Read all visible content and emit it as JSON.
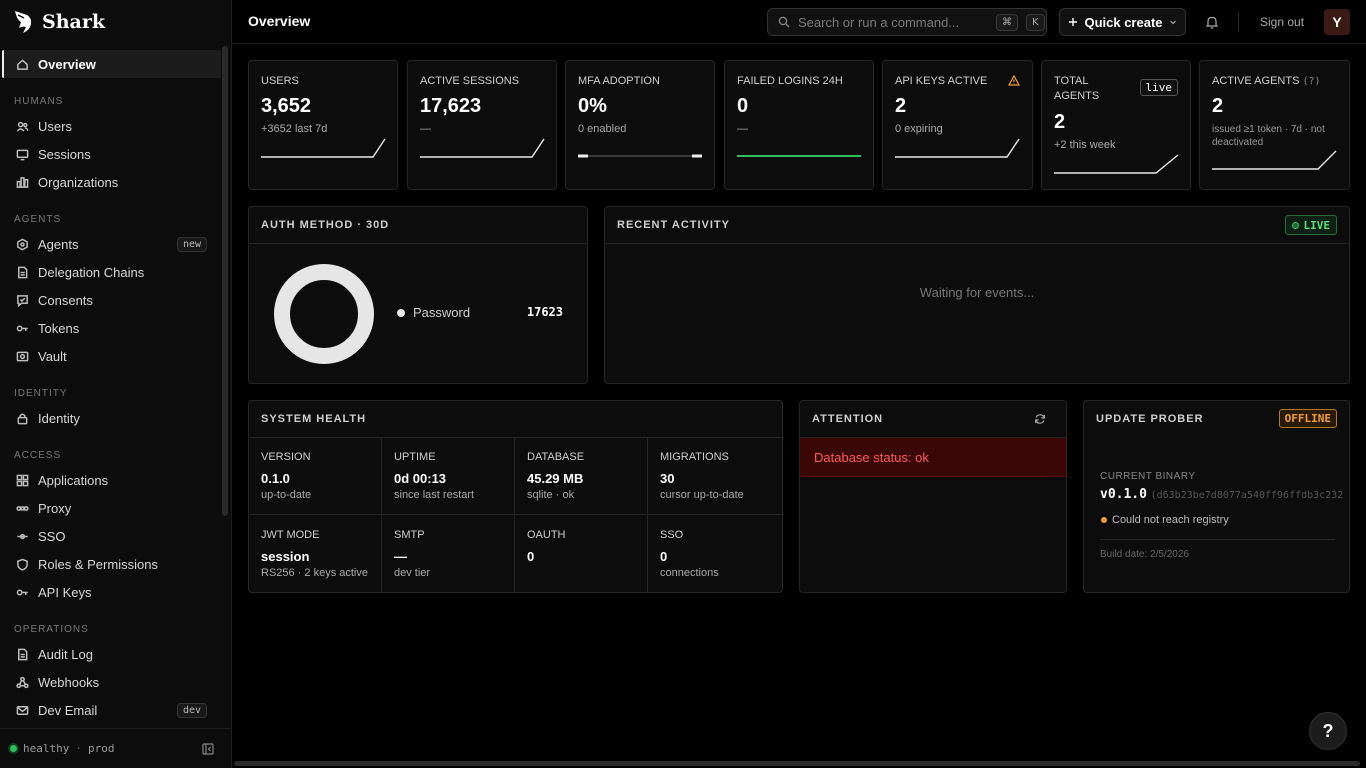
{
  "app": {
    "name": "Shark"
  },
  "header": {
    "title": "Overview",
    "search_placeholder": "Search or run a command...",
    "shortcut_key1": "⌘",
    "shortcut_key2": "K",
    "quick_create_label": "Quick create",
    "sign_out_label": "Sign out",
    "avatar_initial": "Y"
  },
  "sidebar": {
    "overview": "Overview",
    "sections": {
      "humans": "HUMANS",
      "agents": "AGENTS",
      "identity": "IDENTITY",
      "access": "ACCESS",
      "operations": "OPERATIONS"
    },
    "items": {
      "users": "Users",
      "sessions": "Sessions",
      "organizations": "Organizations",
      "agents": "Agents",
      "delegation": "Delegation Chains",
      "consents": "Consents",
      "tokens": "Tokens",
      "vault": "Vault",
      "identity": "Identity",
      "applications": "Applications",
      "proxy": "Proxy",
      "sso": "SSO",
      "roles": "Roles & Permissions",
      "apikeys": "API Keys",
      "audit": "Audit Log",
      "webhooks": "Webhooks",
      "devemail": "Dev Email"
    },
    "badges": {
      "agents": "new",
      "devemail": "dev"
    },
    "footer": {
      "status": "healthy",
      "sep": "·",
      "env": "prod"
    }
  },
  "stats": [
    {
      "label": "USERS",
      "value": "3,652",
      "sub": "+3652 last 7d"
    },
    {
      "label": "ACTIVE SESSIONS",
      "value": "17,623",
      "sub": "—"
    },
    {
      "label": "MFA ADOPTION",
      "value": "0%",
      "sub": "0 enabled"
    },
    {
      "label": "FAILED LOGINS 24H",
      "value": "0",
      "sub": "—"
    },
    {
      "label": "API KEYS ACTIVE",
      "value": "2",
      "sub": "0 expiring"
    },
    {
      "label": "TOTAL AGENTS",
      "value": "2",
      "sub": "+2 this week",
      "pill": "live"
    },
    {
      "label": "ACTIVE AGENTS",
      "hint": "(?)",
      "value": "2",
      "sub": "issued ≥1 token · 7d · not deactivated"
    }
  ],
  "auth_method": {
    "title": "AUTH METHOD · 30D",
    "legend": [
      {
        "name": "Password",
        "value": "17623"
      }
    ]
  },
  "recent_activity": {
    "title": "RECENT ACTIVITY",
    "live_label": "LIVE",
    "empty": "Waiting for events..."
  },
  "system_health": {
    "title": "SYSTEM HEALTH",
    "cells": [
      {
        "k": "VERSION",
        "v": "0.1.0",
        "s": "up-to-date"
      },
      {
        "k": "UPTIME",
        "v": "0d 00:13",
        "s": "since last restart"
      },
      {
        "k": "DATABASE",
        "v": "45.29 MB",
        "s": "sqlite · ok"
      },
      {
        "k": "MIGRATIONS",
        "v": "30",
        "s": "cursor up-to-date"
      },
      {
        "k": "JWT MODE",
        "v": "session",
        "s": "RS256 · 2 keys active"
      },
      {
        "k": "SMTP",
        "v": "—",
        "s": "dev tier"
      },
      {
        "k": "OAUTH",
        "v": "0",
        "s": ""
      },
      {
        "k": "SSO",
        "v": "0",
        "s": "connections"
      }
    ]
  },
  "attention": {
    "title": "ATTENTION",
    "message": "Database status: ok"
  },
  "update_prober": {
    "title": "UPDATE PROBER",
    "status": "OFFLINE",
    "binary_label": "CURRENT BINARY",
    "version": "v0.1.0",
    "hash": "(d63b23be7d8077a540ff96ffdb3c232",
    "warning": "Could not reach registry",
    "build_date": "Build date: 2/5/2026"
  },
  "colors": {
    "accent_green": "#2fbf5a",
    "warning_amber": "#f0a030",
    "danger_red": "#ff5a5a"
  }
}
